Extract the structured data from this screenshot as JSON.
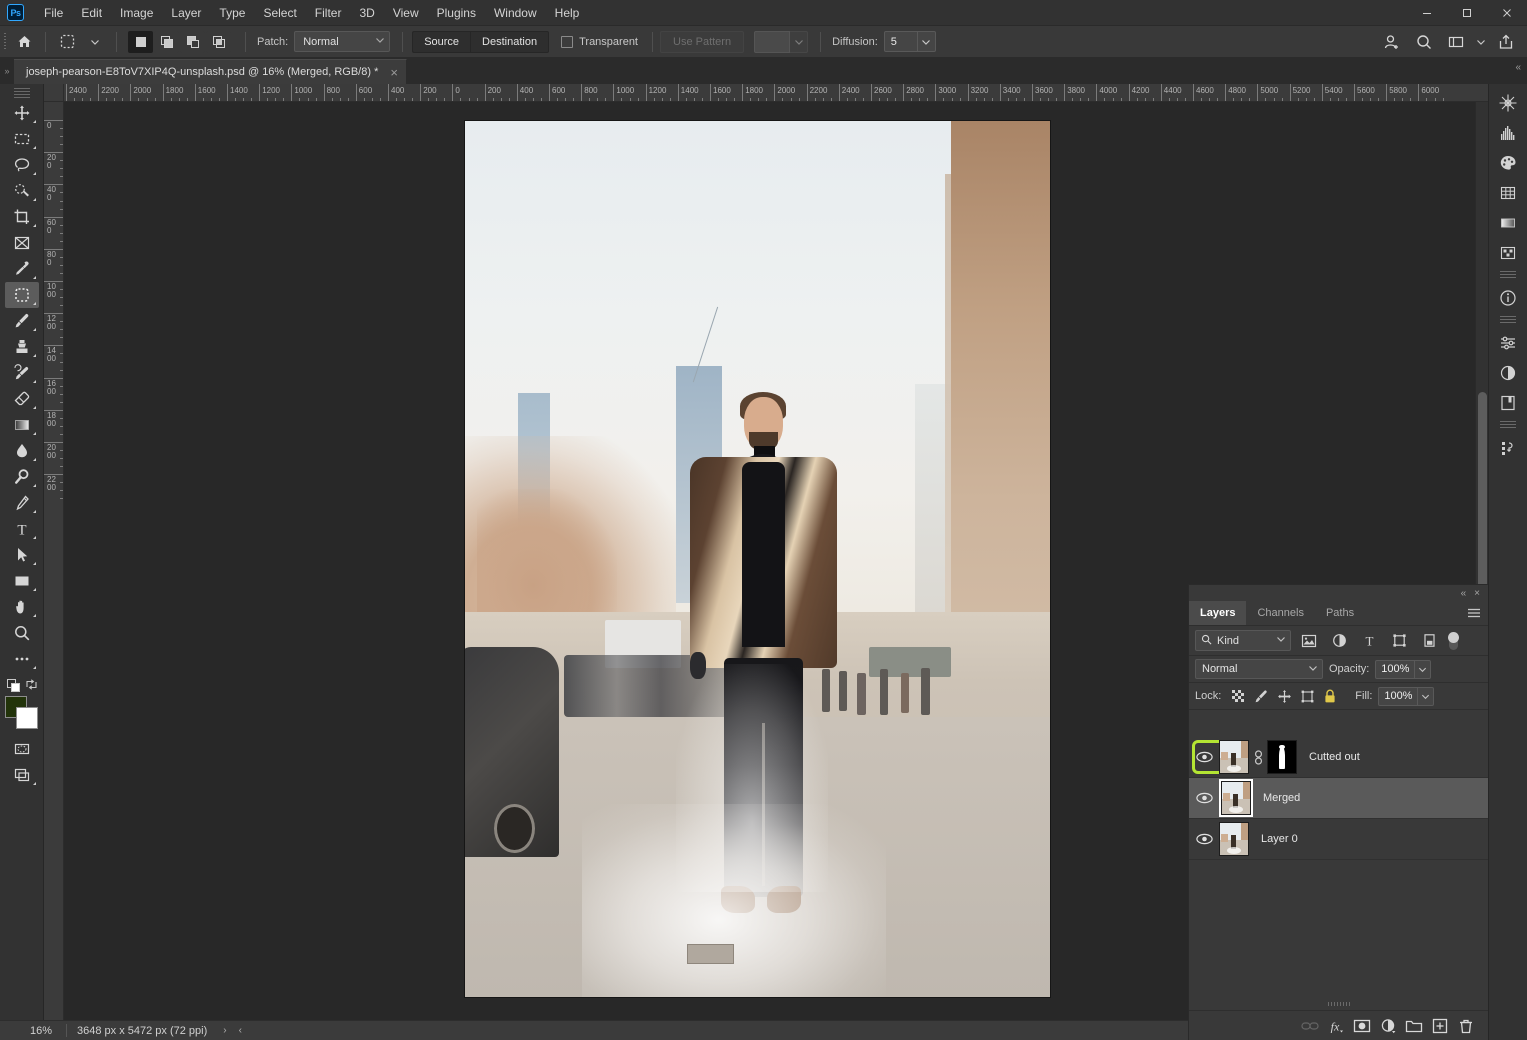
{
  "app": {
    "name": "Adobe Photoshop",
    "logo_text": "Ps"
  },
  "menubar": {
    "items": [
      {
        "label": "File"
      },
      {
        "label": "Edit"
      },
      {
        "label": "Image"
      },
      {
        "label": "Layer"
      },
      {
        "label": "Type"
      },
      {
        "label": "Select"
      },
      {
        "label": "Filter"
      },
      {
        "label": "3D"
      },
      {
        "label": "View"
      },
      {
        "label": "Plugins"
      },
      {
        "label": "Window"
      },
      {
        "label": "Help"
      }
    ]
  },
  "window_controls": {
    "minimize": "minimize-button",
    "maximize": "maximize-button",
    "close": "close-button"
  },
  "options_bar": {
    "home_icon": "home-icon",
    "tool_preset_icon": "patch-tool-icon",
    "selection_modes": [
      {
        "name": "new-selection",
        "active": true
      },
      {
        "name": "add-to-selection",
        "active": false
      },
      {
        "name": "subtract-from-selection",
        "active": false
      },
      {
        "name": "intersect-with-selection",
        "active": false
      }
    ],
    "patch_label": "Patch:",
    "patch_value": "Normal",
    "source_label": "Source",
    "destination_label": "Destination",
    "transparent_label": "Transparent",
    "transparent_checked": false,
    "use_pattern_label": "Use Pattern",
    "use_pattern_disabled": true,
    "diffusion_label": "Diffusion:",
    "diffusion_value": "5",
    "right_icons": [
      "user-add-icon",
      "search-icon",
      "workspace-icon",
      "chevron-down-icon",
      "share-icon"
    ]
  },
  "document_tab": {
    "title": "joseph-pearson-E8ToV7XIP4Q-unsplash.psd @ 16% (Merged, RGB/8) *",
    "close_glyph": "×"
  },
  "toolbar": {
    "tools": [
      {
        "name": "move-tool",
        "glyph": "move",
        "active": false,
        "has_corner": true
      },
      {
        "name": "rectangular-marquee-tool",
        "glyph": "marquee",
        "active": false,
        "has_corner": true
      },
      {
        "name": "lasso-tool",
        "glyph": "lasso",
        "active": false,
        "has_corner": true
      },
      {
        "name": "quick-selection-tool",
        "glyph": "quickselect",
        "active": false,
        "has_corner": true
      },
      {
        "name": "crop-tool",
        "glyph": "crop",
        "active": false,
        "has_corner": true
      },
      {
        "name": "frame-tool",
        "glyph": "frame",
        "active": false,
        "has_corner": false
      },
      {
        "name": "eyedropper-tool",
        "glyph": "eyedropper",
        "active": false,
        "has_corner": true
      },
      {
        "name": "patch-tool",
        "glyph": "patch",
        "active": true,
        "has_corner": true
      },
      {
        "name": "brush-tool",
        "glyph": "brush",
        "active": false,
        "has_corner": true
      },
      {
        "name": "clone-stamp-tool",
        "glyph": "stamp",
        "active": false,
        "has_corner": true
      },
      {
        "name": "history-brush-tool",
        "glyph": "historybrush",
        "active": false,
        "has_corner": true
      },
      {
        "name": "eraser-tool",
        "glyph": "eraser",
        "active": false,
        "has_corner": true
      },
      {
        "name": "gradient-tool",
        "glyph": "gradient",
        "active": false,
        "has_corner": true
      },
      {
        "name": "blur-tool",
        "glyph": "blur",
        "active": false,
        "has_corner": true
      },
      {
        "name": "dodge-tool",
        "glyph": "dodge",
        "active": false,
        "has_corner": true
      },
      {
        "name": "pen-tool",
        "glyph": "pen",
        "active": false,
        "has_corner": true
      },
      {
        "name": "type-tool",
        "glyph": "type",
        "active": false,
        "has_corner": true
      },
      {
        "name": "path-selection-tool",
        "glyph": "pathselect",
        "active": false,
        "has_corner": true
      },
      {
        "name": "rectangle-tool",
        "glyph": "rectangle",
        "active": false,
        "has_corner": true
      },
      {
        "name": "hand-tool",
        "glyph": "hand",
        "active": false,
        "has_corner": true
      },
      {
        "name": "zoom-tool",
        "glyph": "zoom",
        "active": false,
        "has_corner": false
      },
      {
        "name": "edit-toolbar-tool",
        "glyph": "ellipsis",
        "active": false,
        "has_corner": true
      }
    ],
    "foreground_color": "#22330a",
    "background_color": "#ffffff",
    "quick_mask_name": "quick-mask-mode",
    "screen_mode_name": "screen-mode"
  },
  "rulers": {
    "horizontal_ticks": [
      "2400",
      "2200",
      "2000",
      "1800",
      "1600",
      "1400",
      "1200",
      "1000",
      "800",
      "600",
      "400",
      "200",
      "0",
      "200",
      "400",
      "600",
      "800",
      "1000",
      "1200",
      "1400",
      "1600",
      "1800",
      "2000",
      "2200",
      "2400",
      "2600",
      "2800",
      "3000",
      "3200",
      "3400",
      "3600",
      "3800",
      "4000",
      "4200",
      "4400",
      "4600",
      "4800",
      "5000",
      "5200",
      "5400",
      "5600",
      "5800",
      "6000"
    ],
    "vertical_ticks": [
      "0",
      "200",
      "400",
      "600",
      "800",
      "1000",
      "1200",
      "1400",
      "1600",
      "1800",
      "2000",
      "2200"
    ],
    "units": "px"
  },
  "canvas": {
    "document_name": "joseph-pearson-E8ToV7XIP4Q-unsplash.psd",
    "description": "Street photo of a smiling man in a shearling leather jacket standing on a city sidewalk with steam rising, buildings and bare trees behind"
  },
  "status_bar": {
    "zoom": "16%",
    "dimensions": "3648 px x 5472 px (72 ppi)",
    "forward_glyph": "›",
    "back_glyph": "‹"
  },
  "right_dock": {
    "icons": [
      {
        "name": "plugins-icon"
      },
      {
        "name": "histogram-icon"
      },
      {
        "name": "color-palette-icon"
      },
      {
        "name": "swatches-grid-icon"
      },
      {
        "name": "gradients-icon"
      },
      {
        "name": "patterns-icon"
      },
      {
        "name": "info-icon"
      },
      {
        "name": "adjustments-icon"
      },
      {
        "name": "adjustment-layer-icon"
      },
      {
        "name": "libraries-icon"
      },
      {
        "name": "history-icon"
      }
    ]
  },
  "layers_panel": {
    "collapse_glyph": "«",
    "close_glyph": "×",
    "tabs": [
      {
        "label": "Layers",
        "active": true
      },
      {
        "label": "Channels",
        "active": false
      },
      {
        "label": "Paths",
        "active": false
      }
    ],
    "menu_icon": "panel-menu-icon",
    "filter": {
      "search_icon": "search-icon",
      "kind_label": "Kind",
      "icons": [
        "filter-pixel-icon",
        "filter-adjustment-icon",
        "filter-type-icon",
        "filter-shape-icon",
        "filter-smart-object-icon"
      ],
      "toggle_name": "filter-enable-toggle"
    },
    "blend_mode": "Normal",
    "opacity_label": "Opacity:",
    "opacity_value": "100%",
    "lock_label": "Lock:",
    "lock_icons": [
      "lock-transparent-pixels-icon",
      "lock-image-pixels-icon",
      "lock-position-icon",
      "lock-artboard-nesting-icon",
      "lock-all-icon"
    ],
    "fill_label": "Fill:",
    "fill_value": "100%",
    "layers": [
      {
        "name": "Cutted out",
        "visible": true,
        "selected": false,
        "has_mask": true,
        "linked": true,
        "eye_highlighted": true
      },
      {
        "name": "Merged",
        "visible": true,
        "selected": true,
        "has_mask": false,
        "linked": false,
        "eye_highlighted": false
      },
      {
        "name": "Layer 0",
        "visible": true,
        "selected": false,
        "has_mask": false,
        "linked": false,
        "eye_highlighted": false
      }
    ],
    "bottom_buttons": [
      {
        "name": "link-layers-button",
        "label": "link",
        "disabled": true
      },
      {
        "name": "layer-style-button",
        "label": "fx",
        "disabled": false
      },
      {
        "name": "add-layer-mask-button",
        "label": "mask",
        "disabled": false
      },
      {
        "name": "new-adjustment-layer-button",
        "label": "adjustment",
        "disabled": false
      },
      {
        "name": "new-group-button",
        "label": "group",
        "disabled": false
      },
      {
        "name": "new-layer-button",
        "label": "new",
        "disabled": false
      },
      {
        "name": "delete-layer-button",
        "label": "delete",
        "disabled": false
      }
    ]
  },
  "colors": {
    "highlight_green": "#b4e533",
    "panel_bg": "#393939",
    "chrome_bg": "#323232",
    "canvas_bg": "#282828",
    "accent_blue": "#31a8ff"
  }
}
